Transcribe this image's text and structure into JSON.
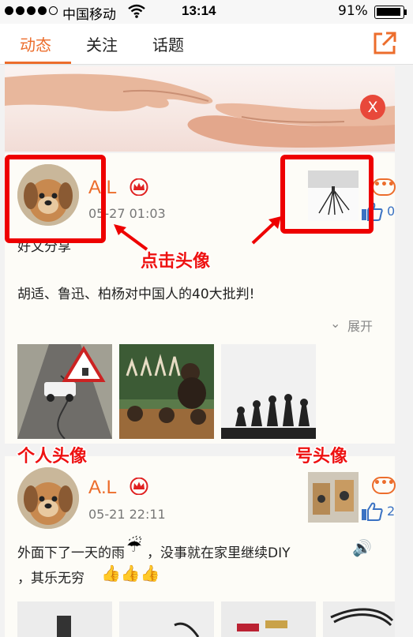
{
  "status_bar": {
    "carrier": "中国移动",
    "time": "13:14",
    "battery": "91%"
  },
  "tabs": [
    {
      "label": "动态"
    },
    {
      "label": "关注"
    },
    {
      "label": "话题"
    }
  ],
  "banner": {
    "close_label": "X"
  },
  "posts": [
    {
      "user": "A.L",
      "time": "05-27 01:03",
      "likes": "0",
      "share_line": "好文分享",
      "text": "胡适、鲁迅、柏杨对中国人的40大批判!",
      "expand_label": "展开"
    },
    {
      "user": "A.L",
      "time": "05-21 22:11",
      "likes": "2",
      "text_line1": "外面下了一天的雨",
      "text_line1b": "，没事就在家里继续DIY",
      "text_line2": "，其乐无穷"
    }
  ],
  "annotations": {
    "click_avatar": "点击头像",
    "personal_avatar": "个人头像",
    "account_avatar": "号头像"
  },
  "colors": {
    "accent": "#ec6d2c",
    "annotation_red": "#ee0000",
    "like_blue": "#3a72c3"
  }
}
